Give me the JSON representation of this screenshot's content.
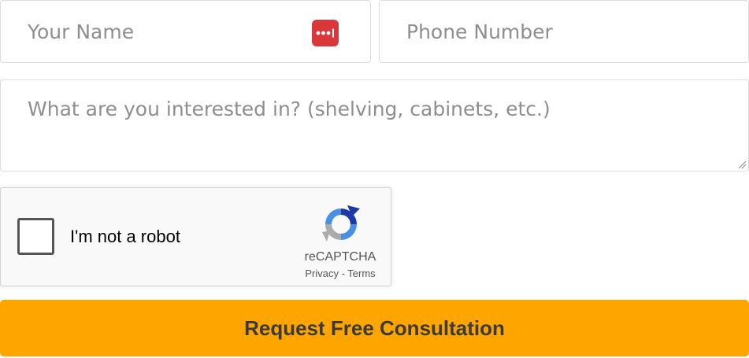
{
  "form": {
    "name_placeholder": "Your Name",
    "phone_placeholder": "Phone Number",
    "interest_placeholder": "What are you interested in? (shelving, cabinets, etc.)",
    "password_manager_icon": "lastpass-dots-icon",
    "colors": {
      "border": "#dcdcdc",
      "placeholder": "#8e8e8e",
      "password_icon": "#d9373a"
    }
  },
  "recaptcha": {
    "checkbox_label": "I'm not a robot",
    "brand": "reCAPTCHA",
    "privacy_link": "Privacy",
    "separator": " - ",
    "terms_link": "Terms",
    "checked": false
  },
  "submit": {
    "label": "Request Free Consultation",
    "color": "#ffa500"
  }
}
